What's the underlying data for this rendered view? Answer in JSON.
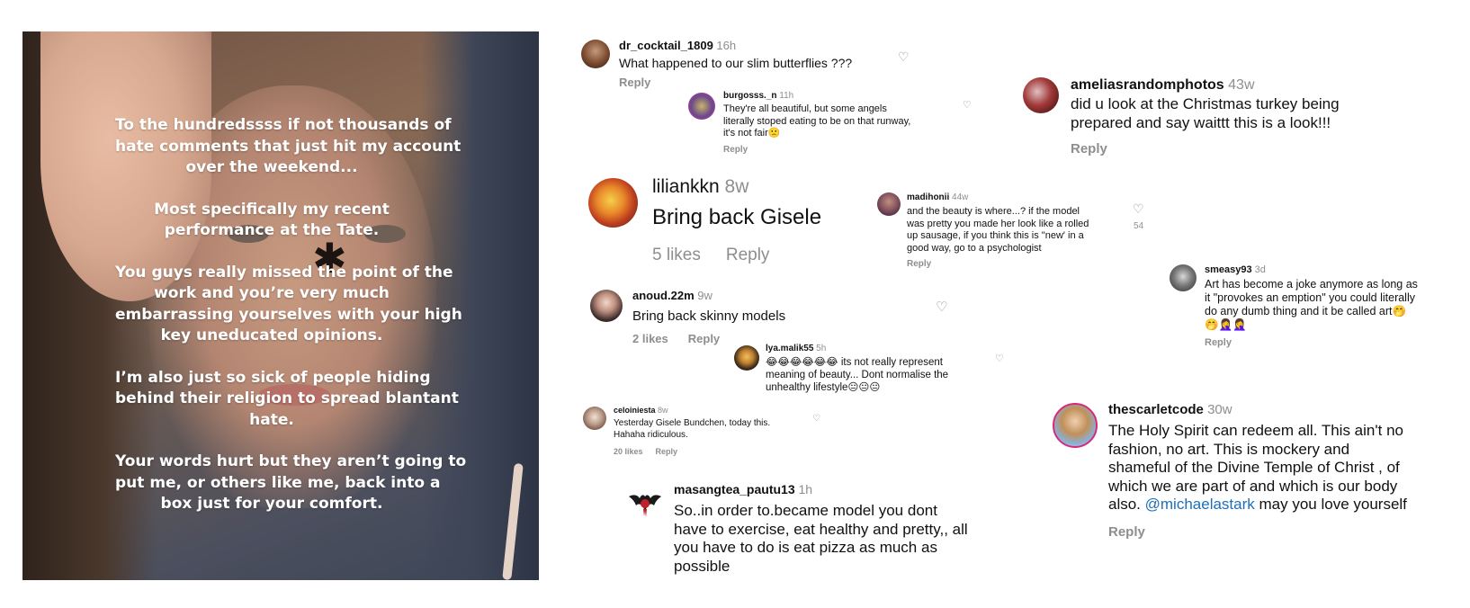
{
  "story": {
    "paragraphs": [
      [
        "To the hundredssss if not thousands of",
        "hate comments that just hit my account",
        "over the weekend..."
      ],
      [
        "Most specifically my recent",
        "performance at the Tate."
      ],
      [
        "You guys really missed the point of the",
        "work and you’re very much",
        "embarrassing yourselves with your high",
        "key uneducated opinions."
      ],
      [
        "I’m also just so sick of people hiding",
        "behind their religion to spread blantant",
        "hate."
      ],
      [
        "Your words hurt but they aren’t going to",
        "put me, or others like me, back into a",
        "box just for your comfort."
      ]
    ]
  },
  "comments": {
    "dr_cocktail": {
      "user": "dr_cocktail_1809",
      "time": "16h",
      "lines": [
        "What happened to our slim butterflies ???"
      ],
      "reply": "Reply",
      "heart_icon": "heart-outline-icon"
    },
    "burgosss": {
      "user": "burgosss._n",
      "time": "11h",
      "lines": [
        "They're all beautiful, but some angels",
        "literally stoped eating to be on that runway,",
        "it's not fair🙁"
      ],
      "reply": "Reply",
      "heart_icon": "heart-outline-icon"
    },
    "ameliasrandomphotos": {
      "user": "ameliasrandomphotos",
      "time": "43w",
      "lines": [
        "did u look at the Christmas turkey being",
        "prepared and say waittt this is a look!!!"
      ],
      "reply": "Reply"
    },
    "liliankkn": {
      "user": "liliankkn",
      "time": "8w",
      "lines": [
        "Bring back Gisele"
      ],
      "likes": "5 likes",
      "reply": "Reply"
    },
    "madihonii": {
      "user": "madihonii",
      "time": "44w",
      "lines": [
        "and the beauty is where...? if the model",
        "was pretty you made her look like a rolled",
        "up sausage, if you think this is \"new' in a",
        "good way, go to a psychologist"
      ],
      "reply": "Reply",
      "heart_count": "54",
      "heart_icon": "heart-outline-icon"
    },
    "smeasy93": {
      "user": "smeasy93",
      "time": "3d",
      "lines": [
        "Art has become a joke anymore as long as",
        "it \"provokes an emption\" you could literally",
        "do any dumb thing and it be called art🤭",
        "🤭🤦‍♀️🤦‍♀️"
      ],
      "reply": "Reply"
    },
    "anoud": {
      "user": "anoud.22m",
      "time": "9w",
      "lines": [
        "Bring back skinny models"
      ],
      "likes": "2 likes",
      "reply": "Reply",
      "heart_icon": "heart-outline-icon"
    },
    "lya": {
      "user": "lya.malik55",
      "time": "5h",
      "lines": [
        "😂😂😂😂😂😂 its not really represent",
        "meaning of beauty... Dont normalise the",
        "unhealthy lifestyle😐😐😐"
      ],
      "heart_icon": "heart-outline-icon"
    },
    "celoiniesta": {
      "user": "celoiniesta",
      "time": "8w",
      "lines": [
        "Yesterday Gisele Bundchen, today this.",
        "Hahaha ridiculous."
      ],
      "likes": "20 likes",
      "reply": "Reply",
      "heart_icon": "heart-outline-icon"
    },
    "thescarletcode": {
      "user": "thescarletcode",
      "time": "30w",
      "lines": [
        "The Holy Spirit can redeem all. This ain't no",
        "fashion, no art. This is mockery and",
        "shameful of the Divine Temple of Christ , of",
        "which we are part of and which is our body"
      ],
      "last_prefix": "also. ",
      "mention": "@michaelastark",
      "last_suffix": " may you love yourself",
      "reply": "Reply"
    },
    "masangtea": {
      "user": "masangtea_pautu13",
      "time": "1h",
      "lines": [
        "So..in order to.became model you dont",
        "have to exercise, eat healthy and pretty,, all",
        "you have to do is eat pizza as much as",
        "possible"
      ]
    }
  }
}
